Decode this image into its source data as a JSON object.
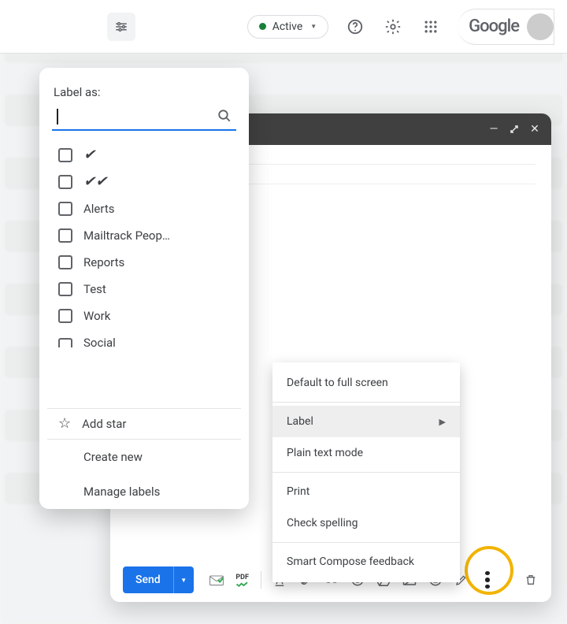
{
  "topbar": {
    "status": "Active",
    "logo": "Google"
  },
  "compose": {
    "send": "Send"
  },
  "more_menu": {
    "full_screen": "Default to full screen",
    "label": "Label",
    "plain": "Plain text mode",
    "print": "Print",
    "spell": "Check spelling",
    "smart": "Smart Compose feedback"
  },
  "label_panel": {
    "title": "Label as:",
    "labels": [
      "✔",
      "✔✔",
      "Alerts",
      "Mailtrack Peop…",
      "Reports",
      "Test",
      "Work",
      "Social"
    ],
    "add_star": "Add star",
    "create": "Create new",
    "manage": "Manage labels"
  }
}
